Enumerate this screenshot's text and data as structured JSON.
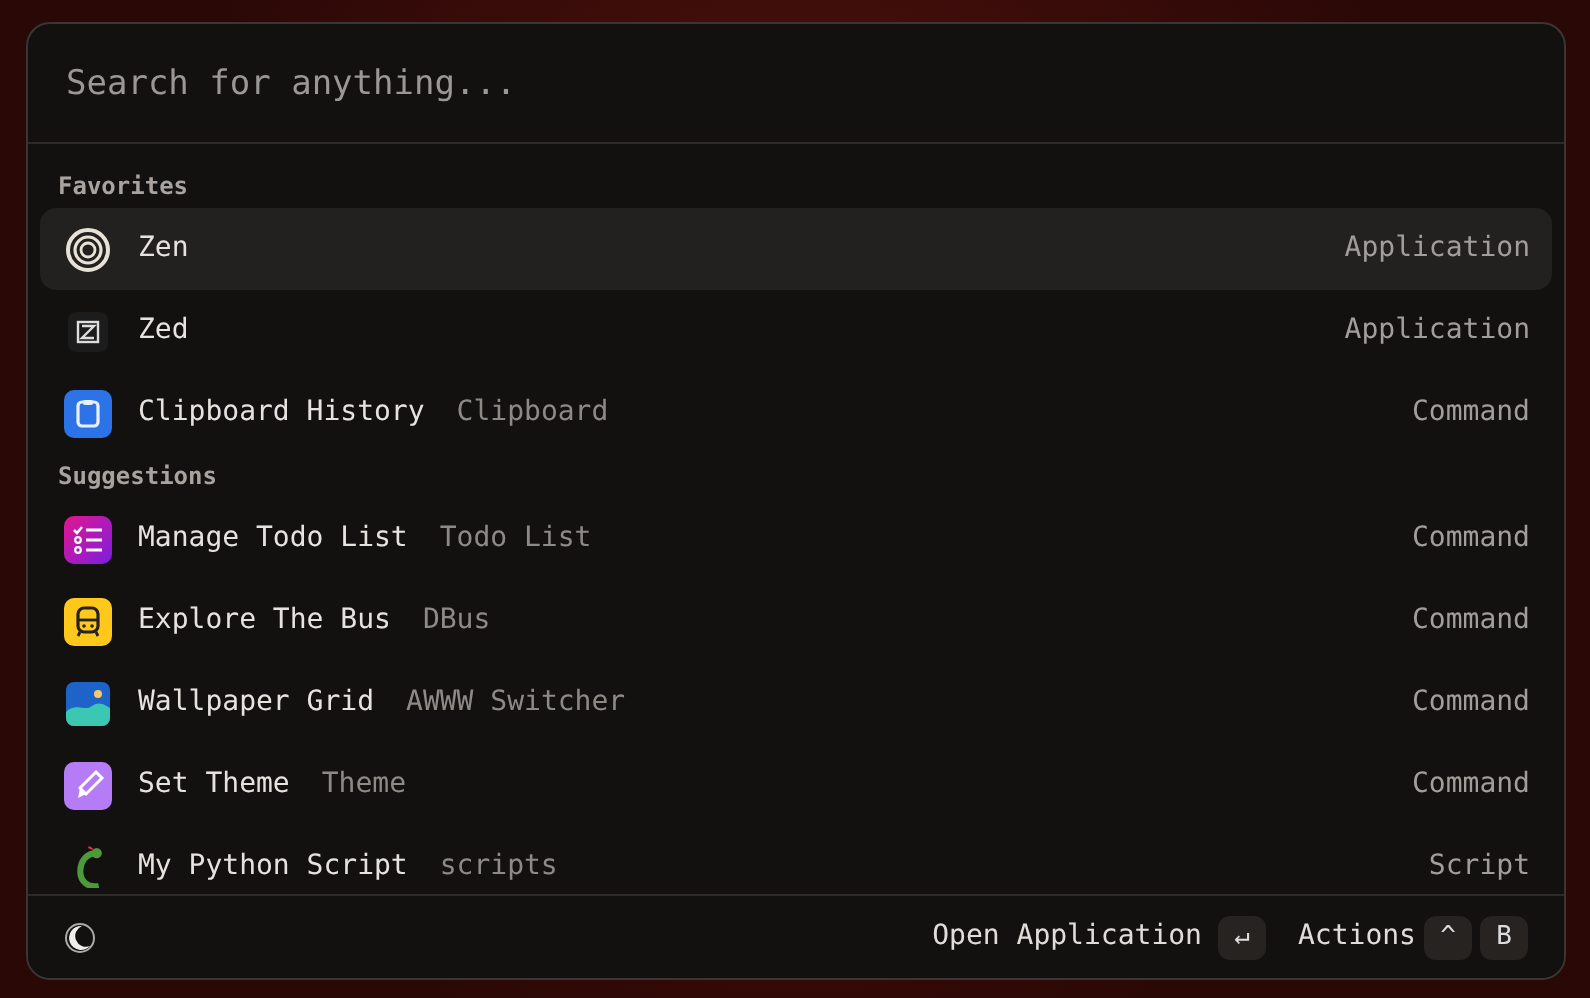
{
  "search": {
    "placeholder": "Search for anything..."
  },
  "sections": [
    {
      "title": "Favorites",
      "items": [
        {
          "kind": "zen",
          "title": "Zen",
          "type": "Application",
          "selected": true
        },
        {
          "kind": "zed",
          "title": "Zed",
          "type": "Application",
          "selected": false
        },
        {
          "kind": "clipboard",
          "title": "Clipboard History",
          "subtitle": "Clipboard",
          "type": "Command",
          "selected": false
        }
      ]
    },
    {
      "title": "Suggestions",
      "items": [
        {
          "kind": "todo",
          "title": "Manage Todo List",
          "subtitle": "Todo List",
          "type": "Command",
          "selected": false
        },
        {
          "kind": "bus",
          "title": "Explore The Bus",
          "subtitle": "DBus",
          "type": "Command",
          "selected": false
        },
        {
          "kind": "wallpaper",
          "title": "Wallpaper Grid",
          "subtitle": "AWWW Switcher",
          "type": "Command",
          "selected": false
        },
        {
          "kind": "brush",
          "title": "Set Theme",
          "subtitle": "Theme",
          "type": "Command",
          "selected": false
        },
        {
          "kind": "snake",
          "title": "My Python Script",
          "subtitle": "scripts",
          "type": "Script",
          "selected": false
        }
      ]
    }
  ],
  "footer": {
    "primary_action": "Open Application",
    "primary_key": "↵",
    "actions_label": "Actions",
    "action_keys": [
      "^",
      "B"
    ]
  }
}
